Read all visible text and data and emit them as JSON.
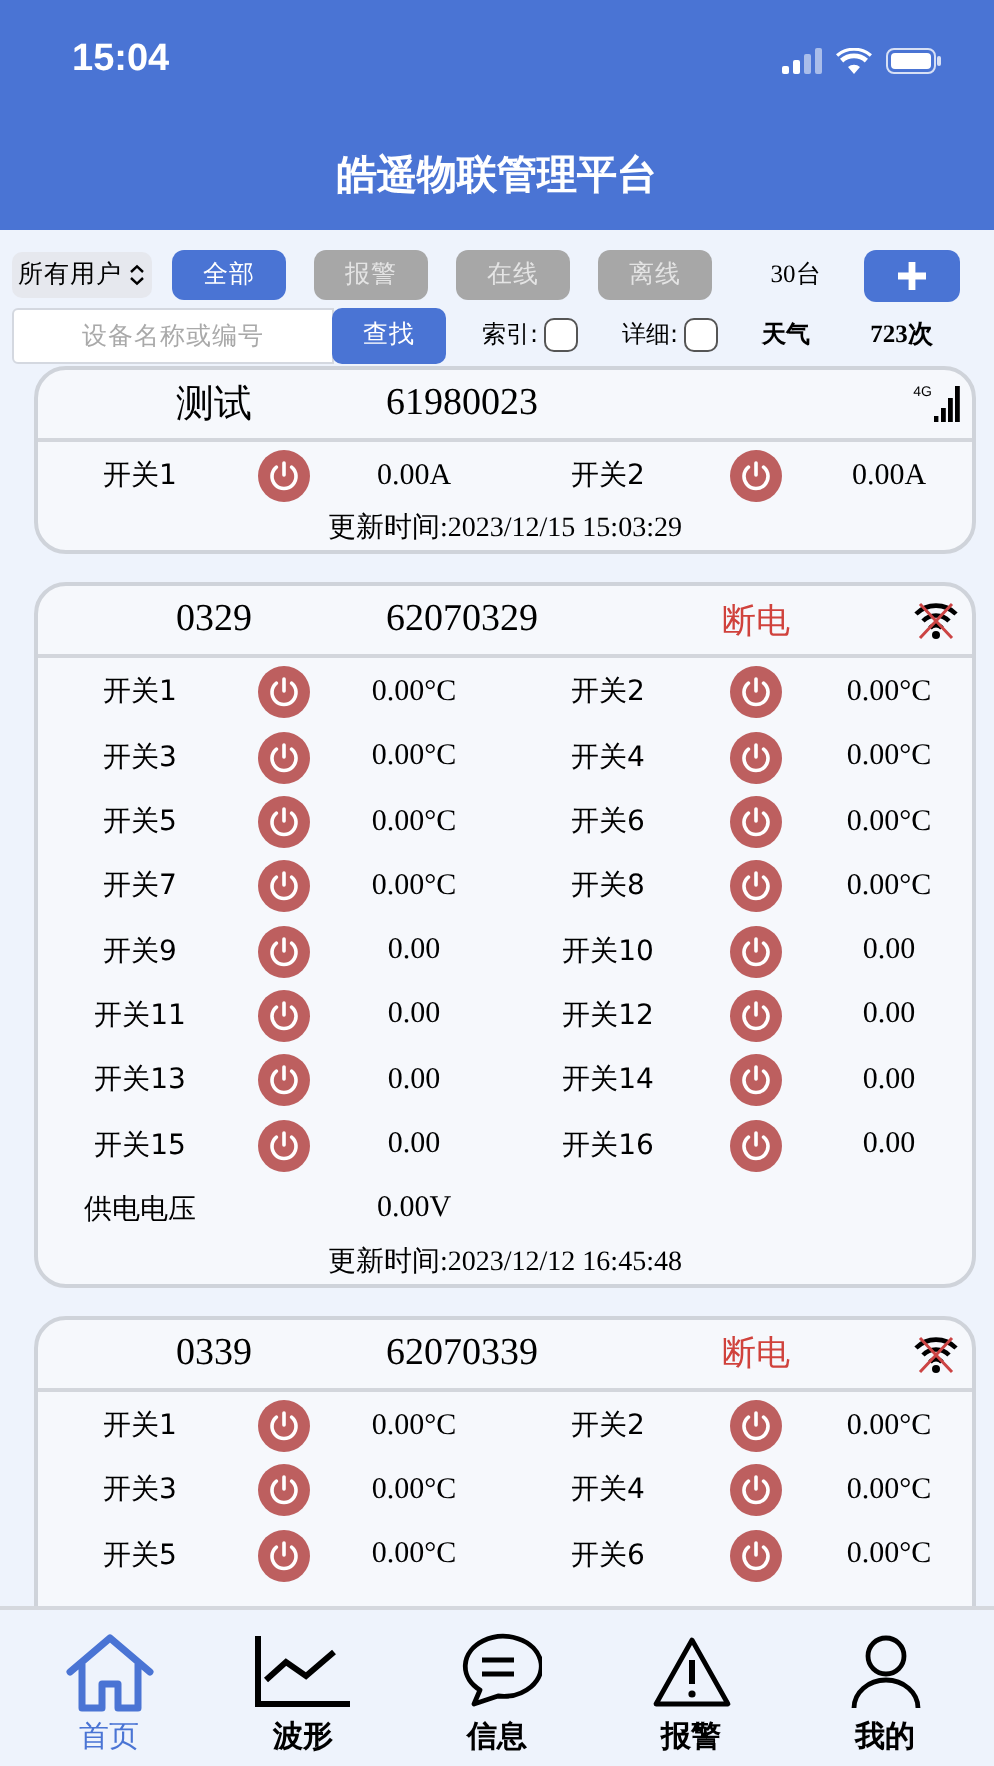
{
  "status_bar": {
    "time": "15:04"
  },
  "header": {
    "title": "皓遥物联管理平台"
  },
  "toolbar": {
    "user_select": "所有用户",
    "filters": [
      {
        "label": "全部",
        "selected": true
      },
      {
        "label": "报警",
        "selected": false
      },
      {
        "label": "在线",
        "selected": false
      },
      {
        "label": "离线",
        "selected": false
      }
    ],
    "count": "30台",
    "search": {
      "placeholder": "设备名称或编号",
      "button": "查找"
    },
    "options": [
      {
        "label": "索引:",
        "checked": false
      },
      {
        "label": "详细:",
        "checked": false
      }
    ],
    "weather": "天气",
    "visits": "723次"
  },
  "devices": [
    {
      "name": "测试",
      "id": "61980023",
      "network": {
        "kind": "cellular",
        "label": "4G"
      },
      "switches": [
        {
          "label": "开关1",
          "reading": "0.00A"
        },
        {
          "label": "开关2",
          "reading": "0.00A"
        }
      ],
      "updated": "更新时间:2023/12/15 15:03:29"
    },
    {
      "name": "0329",
      "id": "62070329",
      "status": "断电",
      "network": {
        "kind": "offline"
      },
      "switches": [
        {
          "label": "开关1",
          "reading": "0.00°C"
        },
        {
          "label": "开关2",
          "reading": "0.00°C"
        },
        {
          "label": "开关3",
          "reading": "0.00°C"
        },
        {
          "label": "开关4",
          "reading": "0.00°C"
        },
        {
          "label": "开关5",
          "reading": "0.00°C"
        },
        {
          "label": "开关6",
          "reading": "0.00°C"
        },
        {
          "label": "开关7",
          "reading": "0.00°C"
        },
        {
          "label": "开关8",
          "reading": "0.00°C"
        },
        {
          "label": "开关9",
          "reading": "0.00"
        },
        {
          "label": "开关10",
          "reading": "0.00"
        },
        {
          "label": "开关11",
          "reading": "0.00"
        },
        {
          "label": "开关12",
          "reading": "0.00"
        },
        {
          "label": "开关13",
          "reading": "0.00"
        },
        {
          "label": "开关14",
          "reading": "0.00"
        },
        {
          "label": "开关15",
          "reading": "0.00"
        },
        {
          "label": "开关16",
          "reading": "0.00"
        }
      ],
      "voltage": {
        "label": "供电电压",
        "reading": "0.00V"
      },
      "updated": "更新时间:2023/12/12 16:45:48"
    },
    {
      "name": "0339",
      "id": "62070339",
      "status": "断电",
      "network": {
        "kind": "offline"
      },
      "switches": [
        {
          "label": "开关1",
          "reading": "0.00°C"
        },
        {
          "label": "开关2",
          "reading": "0.00°C"
        },
        {
          "label": "开关3",
          "reading": "0.00°C"
        },
        {
          "label": "开关4",
          "reading": "0.00°C"
        },
        {
          "label": "开关5",
          "reading": "0.00°C"
        },
        {
          "label": "开关6",
          "reading": "0.00°C"
        }
      ]
    }
  ],
  "tab_bar": [
    {
      "label": "首页",
      "kind": "home",
      "selected": true
    },
    {
      "label": "波形",
      "kind": "chart",
      "selected": false
    },
    {
      "label": "信息",
      "kind": "message",
      "selected": false
    },
    {
      "label": "报警",
      "kind": "warning",
      "selected": false
    },
    {
      "label": "我的",
      "kind": "person",
      "selected": false
    }
  ]
}
